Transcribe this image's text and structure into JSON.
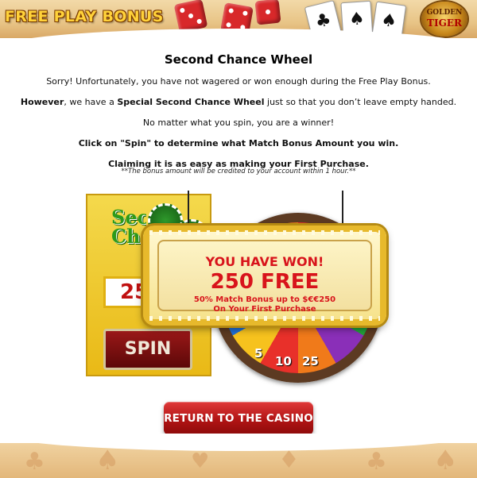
{
  "header": {
    "logo_text": "FREE PLAY BONUS",
    "brand_top": "GOLDEN",
    "brand_bottom": "TIGER"
  },
  "content": {
    "title": "Second Chance Wheel",
    "line1": "Sorry! Unfortunately, you have not wagered or won enough during the Free Play Bonus.",
    "line2_bold": "However",
    "line2_mid": ", we have a ",
    "line2_highlight": "Special Second Chance Wheel",
    "line2_end": " just so that you don’t leave empty handed.",
    "line3": "No matter what you spin, you are a winner!",
    "line4": "Click on \"Spin\" to determine what Match Bonus Amount you win.",
    "line5": "Claiming it is as easy as making your First Purchase.",
    "note": "**The bonus amount will be credited to your account within 1 hour.**"
  },
  "game": {
    "panel_title_1": "Second",
    "panel_title_2": "Chance",
    "amount_display": "25",
    "spin_label": "SPIN",
    "wheel_numbers": [
      "25",
      "5",
      "10",
      "25"
    ],
    "sign_line1": "YOU HAVE WON!",
    "sign_line2": "250 FREE",
    "sign_line3": "50% Match Bonus up to $€€250",
    "sign_line4": "On Your First Purchase"
  },
  "actions": {
    "return_label": "RETURN TO THE CASINO"
  },
  "colors": {
    "accent_red": "#d8131b",
    "button_red": "#b01414",
    "gold": "#e7b92c"
  }
}
